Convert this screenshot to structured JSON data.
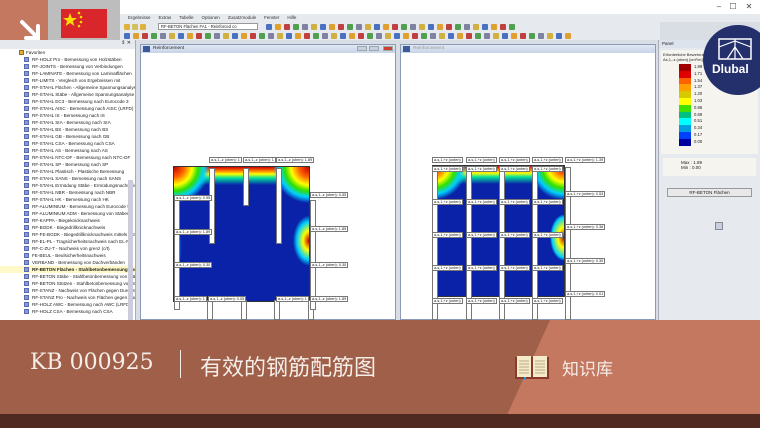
{
  "menu": [
    "Ergebnisse",
    "Extras",
    "Tabelle",
    "Optionen",
    "Zusatzmodule",
    "Fenster",
    "Hilfe"
  ],
  "toolbar": {
    "module_select": "RF-BETON Flächen FA1 - Reinforced co"
  },
  "window_controls": {
    "minimize": "–",
    "maximize": "☐",
    "close": "✕"
  },
  "navigator": {
    "pin": "⇕ ✕",
    "folder": "Favoriten",
    "items": [
      "RF-HOLZ Pro - Bemessung von Holzstäben",
      "RF-JOINTS - Bemessung von Verbindungen",
      "RF-LAMINATE - Bemessung von Laminatflächen",
      "RF-LIMITS - Vergleich von Ergebnissen mit",
      "RF-STAHL Flächen - Allgemeine Spannungsanalyse",
      "RF-STAHL Stäbe - Allgemeine Spannungsanalyse",
      "RF-STAHL EC3 - Bemessung nach Eurocode 3",
      "RF-STAHL AISC - Bemessung nach AISC (LRFD)",
      "RF-STAHL IS - Bemessung nach IS",
      "RF-STAHL SIA - Bemessung nach SIA",
      "RF-STAHL BS - Bemessung nach BS",
      "RF-STAHL GB - Bemessung nach GB",
      "RF-STAHL CSA - Bemessung nach CSA",
      "RF-STAHL AS - Bemessung nach AS",
      "RF-STAHL NTC-DF - Bemessung nach NTC-DF",
      "RF-STAHL SP - Bemessung nach SP",
      "RF-STAHL Plastisch - Plastische Bemessung",
      "RF-STAHL SANS - Bemessung nach SANS",
      "RF-STAHL Ermüdung Stäbe - Ermüdungsnachweis",
      "RF-STAHL NBR - Bemessung nach NBR",
      "RF-STAHL HK - Bemessung nach HK",
      "RF-ALUMINIUM - Bemessung nach Eurocode 9",
      "RF-ALUMINIUM ADM - Bemessung von Stäben",
      "RF-KAPPA - Biegeknicknachweis",
      "RF-BGDK - Biegedrillknicknachweis",
      "RF-FE-BGDK - Biegedrillknicknachweis mittels FEM",
      "RF-EL-PL - Tragsicherheitsnachweis nach EL-PL",
      "RF-C-ZU-T - Nachweis von grenz (c/t)",
      "FE-BEUL - Beulsicherheitsnachweis",
      "VERBAND - Bemessung von Dachverbänden",
      "RF-BETON Flächen - Stahlbetonbemessung von Flächen",
      "RF-BETON Stäbe - Stahlbetonbemessung von Stäben",
      "RF-BETON Stützen - Stahlbetonbemessung von Stützen",
      "RF-STANZ - Nachweis von Flächen gegen Durchstanzen",
      "RF-STANZ Pro - Nachweis von Flächen gegen Durchstanzen",
      "RF-HOLZ AWC - Bemessung nach AWC (LRFD)",
      "RF-HOLZ CSA - Bemessung nach CSA"
    ],
    "highlighted_index": 30
  },
  "windows": [
    {
      "title": "Reinforcement",
      "h_labels": [
        "a-s,1,-z (oben): 1",
        "a-s,1,-z (oben): 1",
        "a-s,1,-z (oben): 1.89",
        "a-s,1,-z (oben): 0.55",
        "a-s,1,-z (oben): 0.55",
        "a-s,1,-z (oben): 1.89",
        "a-s,1,-z (oben): 1.89",
        "a-s,1,-z (oben): 0.30",
        "a-s,1,-z (oben): 0.30",
        "a-s,1,-z (oben): 1",
        "a-s,1,-z (oben): 0.05",
        "a-s,1,-z (oben): 1",
        "a-s,1,-z (oben): 1.89"
      ]
    },
    {
      "title": "Reinforcement",
      "h_labels": [
        "a-s,1,+z (unten)",
        "a-s,1,+z (unten)",
        "a-s,1,+z (unten)",
        "a-s,1,+z (unten)",
        "a-s,1,+z (unten): 1.39",
        "a-s,1,+z (unten): 0.53",
        "a-s,1,+z (unten): 0.36",
        "a-s,1,+z (unten): 0.30",
        "a-s,1,+z (unten): 0.01"
      ]
    }
  ],
  "panel": {
    "title": "Panel",
    "heading": "Erforderliche Bewehrung",
    "unit": "As,1,-z (oben) [cm²/m]",
    "legend_values": [
      "1.89",
      "1.71",
      "1.54",
      "1.37",
      "1.20",
      "1.03",
      "0.86",
      "0.69",
      "0.51",
      "0.34",
      "0.17",
      "0.00"
    ],
    "legend_colors": [
      "#a00000",
      "#e00000",
      "#ff6000",
      "#ffa000",
      "#d8c800",
      "#ffff00",
      "#40e000",
      "#00c080",
      "#00ffff",
      "#00a0e0",
      "#0040ff",
      "#0000a0"
    ],
    "max_label": "Max :",
    "max": "1.89",
    "min_label": "Min :",
    "min": "0.00",
    "button": "RF-BETON Flächen"
  },
  "logo": "Dlubal",
  "banner": {
    "code": "KB 000925",
    "title": "有效的钢筋配筋图",
    "link": "知识库"
  }
}
